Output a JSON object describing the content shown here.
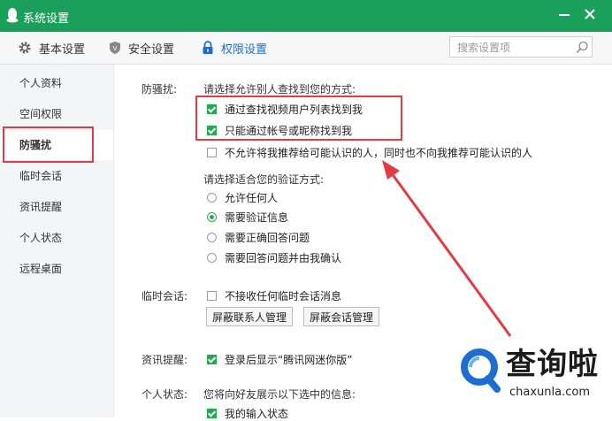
{
  "window": {
    "title": "系统设置"
  },
  "toolbar": {
    "tabs": [
      {
        "label": "基本设置"
      },
      {
        "label": "安全设置"
      },
      {
        "label": "权限设置"
      }
    ],
    "search_placeholder": "搜索设置项"
  },
  "sidebar": {
    "items": [
      {
        "label": "个人资料"
      },
      {
        "label": "空间权限"
      },
      {
        "label": "防骚扰"
      },
      {
        "label": "临时会话"
      },
      {
        "label": "资讯提醒"
      },
      {
        "label": "个人状态"
      },
      {
        "label": "远程桌面"
      }
    ],
    "active": "防骚扰"
  },
  "anti_harass": {
    "section_label": "防骚扰:",
    "find_prompt": "请选择允许别人查找到您的方式:",
    "find_options": [
      {
        "label": "通过查找视频用户列表找到我",
        "checked": true
      },
      {
        "label": "只能通过帐号或昵称找到我",
        "checked": true
      },
      {
        "label": "不允许将我推荐给可能认识的人，同时也不向我推荐可能认识的人",
        "checked": false
      }
    ],
    "verify_prompt": "请选择适合您的验证方式:",
    "verify_options": [
      {
        "label": "允许任何人",
        "selected": false
      },
      {
        "label": "需要验证信息",
        "selected": true
      },
      {
        "label": "需要正确回答问题",
        "selected": false
      },
      {
        "label": "需要回答问题并由我确认",
        "selected": false
      }
    ]
  },
  "temp_session": {
    "section_label": "临时会话:",
    "option": {
      "label": "不接收任何临时会话消息",
      "checked": false
    },
    "buttons": {
      "block_contacts": "屏蔽联系人管理",
      "block_sessions": "屏蔽会话管理"
    }
  },
  "news": {
    "section_label": "资讯提醒:",
    "option": {
      "label": "登录后显示“腾讯网迷你版”",
      "checked": true
    }
  },
  "status": {
    "section_label": "个人状态:",
    "prompt": "您将向好友展示以下选中的信息:",
    "option": {
      "label": "我的输入状态",
      "checked": true
    }
  },
  "watermark": {
    "text": "查询啦",
    "url": "chaxunla.com"
  },
  "colors": {
    "title_bar": "#1aa05a",
    "accent": "#1c6fd1",
    "check": "#26a84f",
    "highlight": "#e23b44"
  }
}
